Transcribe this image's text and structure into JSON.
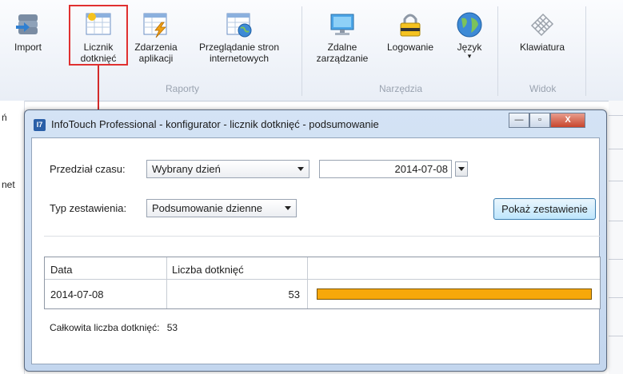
{
  "ribbon": {
    "buttons": [
      {
        "name": "import",
        "label1": "Import",
        "label2": ""
      },
      {
        "name": "touch-counter",
        "label1": "Licznik",
        "label2": "dotknięć"
      },
      {
        "name": "app-events",
        "label1": "Zdarzenia",
        "label2": "aplikacji"
      },
      {
        "name": "web-browsing",
        "label1": "Przeglądanie stron",
        "label2": "internetowych"
      },
      {
        "name": "remote-management",
        "label1": "Zdalne",
        "label2": "zarządzanie"
      },
      {
        "name": "logging",
        "label1": "Logowanie",
        "label2": ""
      },
      {
        "name": "language",
        "label1": "Język",
        "label2": ""
      },
      {
        "name": "keyboard",
        "label1": "Klawiatura",
        "label2": ""
      }
    ],
    "groups": {
      "reports": "Raporty",
      "tools": "Narzędzia",
      "view": "Widok"
    }
  },
  "background": {
    "left_text1": "ń",
    "left_text2": "net"
  },
  "dialog": {
    "app_icon_text": "I7",
    "title": "InfoTouch Professional - konfigurator - licznik dotknięć - podsumowanie",
    "minimize": "—",
    "maximize": "▫",
    "close": "X",
    "time_range_label": "Przedział czasu:",
    "time_range_value": "Wybrany dzień",
    "date_value": "2014-07-08",
    "summary_type_label": "Typ zestawienia:",
    "summary_type_value": "Podsumowanie dzienne",
    "show_button": "Pokaż zestawienie",
    "table": {
      "headers": [
        "Data",
        "Liczba dotknięć",
        ""
      ],
      "rows": [
        {
          "date": "2014-07-08",
          "count": "53",
          "bar_fraction": 1.0
        }
      ]
    },
    "total_label": "Całkowita liczba dotknięć:",
    "total_value": "53"
  },
  "colors": {
    "bar": "#f7a80a",
    "highlight": "#e03030",
    "accent": "#3c7fb1"
  }
}
